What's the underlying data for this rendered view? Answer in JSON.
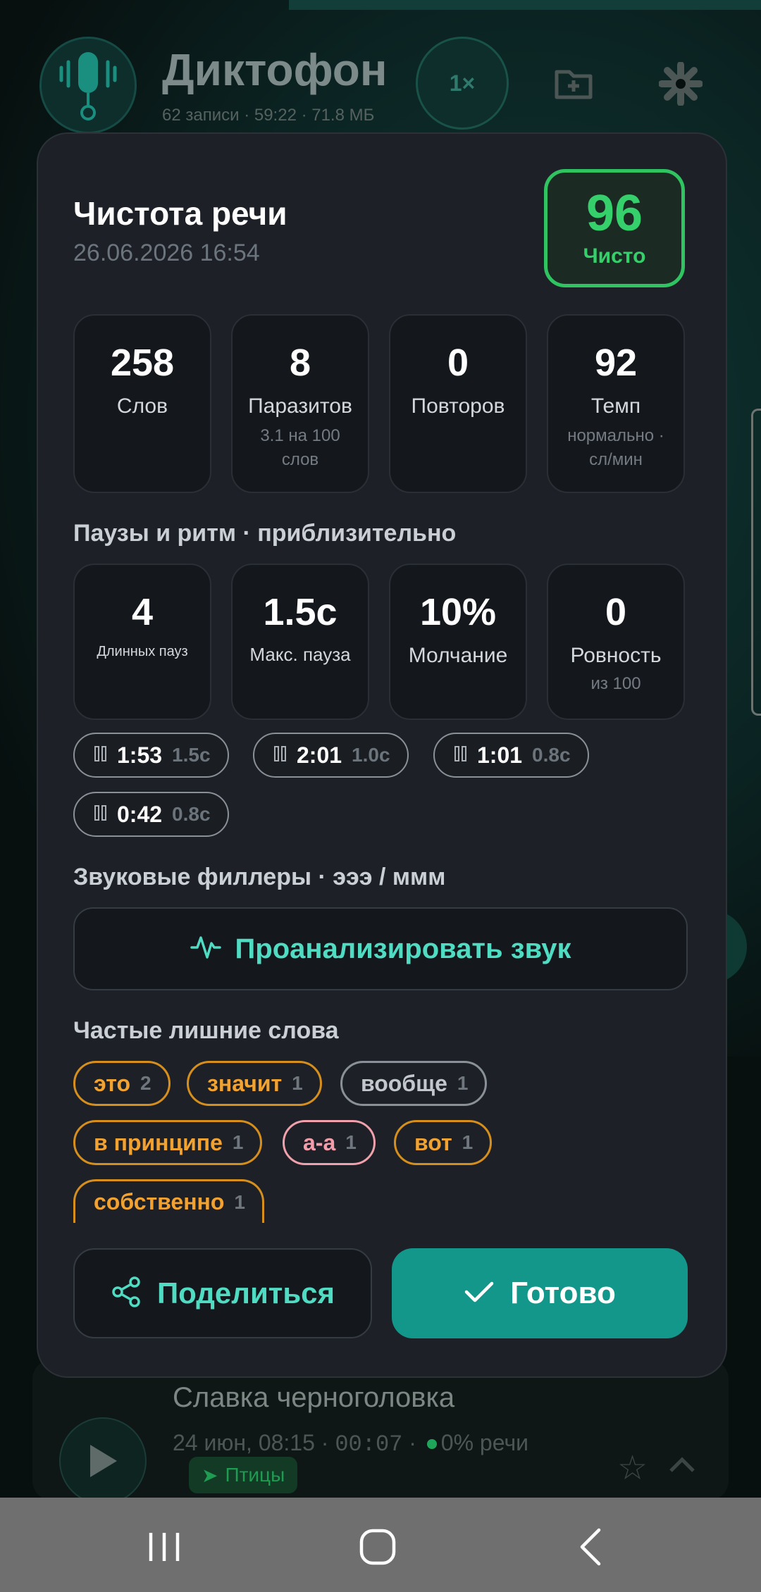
{
  "app": {
    "title": "Диктофон",
    "subtitle": "62 записи · 59:22 · 71.8 МБ",
    "speed": "1×"
  },
  "modal": {
    "title": "Чистота речи",
    "date": "26.06.2026 16:54",
    "score": {
      "value": "96",
      "label": "Чисто",
      "color": "#35d06b"
    },
    "stats": [
      {
        "value": "258",
        "label": "Слов",
        "sub": ""
      },
      {
        "value": "8",
        "label": "Паразитов",
        "sub": "3.1 на 100 слов"
      },
      {
        "value": "0",
        "label": "Повторов",
        "sub": ""
      },
      {
        "value": "92",
        "label": "Темп",
        "sub": "нормально · сл/мин"
      }
    ],
    "pauses_section": "Паузы и ритм · приблизительно",
    "pause_stats": [
      {
        "value": "4",
        "label": "Длинных пауз",
        "sub": ""
      },
      {
        "value": "1.5с",
        "label": "Макс. пауза",
        "sub": ""
      },
      {
        "value": "10%",
        "label": "Молчание",
        "sub": ""
      },
      {
        "value": "0",
        "label": "Ровность",
        "sub": "из 100"
      }
    ],
    "pause_pills": [
      {
        "time": "1:53",
        "dur": "1.5с"
      },
      {
        "time": "2:01",
        "dur": "1.0с"
      },
      {
        "time": "1:01",
        "dur": "0.8с"
      },
      {
        "time": "0:42",
        "dur": "0.8с"
      }
    ],
    "fillers_section": "Звуковые филлеры · эээ / ммм",
    "analyze_label": "Проанализировать звук",
    "words_section": "Частые лишние слова",
    "words": [
      {
        "word": "это",
        "count": "2"
      },
      {
        "word": "значит",
        "count": "1"
      },
      {
        "word": "вообще",
        "count": "1"
      },
      {
        "word": "в принципе",
        "count": "1"
      },
      {
        "word": "а-а",
        "count": "1"
      },
      {
        "word": "вот",
        "count": "1"
      },
      {
        "word": "собственно",
        "count": "1"
      }
    ],
    "share_label": "Поделиться",
    "done_label": "Готово"
  },
  "background_record": {
    "title": "Славка черноголовка",
    "date": "24 июн, 08:15",
    "duration": "00:07",
    "speech": "0% речи",
    "tag": "Птицы"
  },
  "colors": {
    "accent": "#12978a",
    "accent_text": "#4fdcc2",
    "good": "#35d06b",
    "warn": "#f2a230"
  }
}
